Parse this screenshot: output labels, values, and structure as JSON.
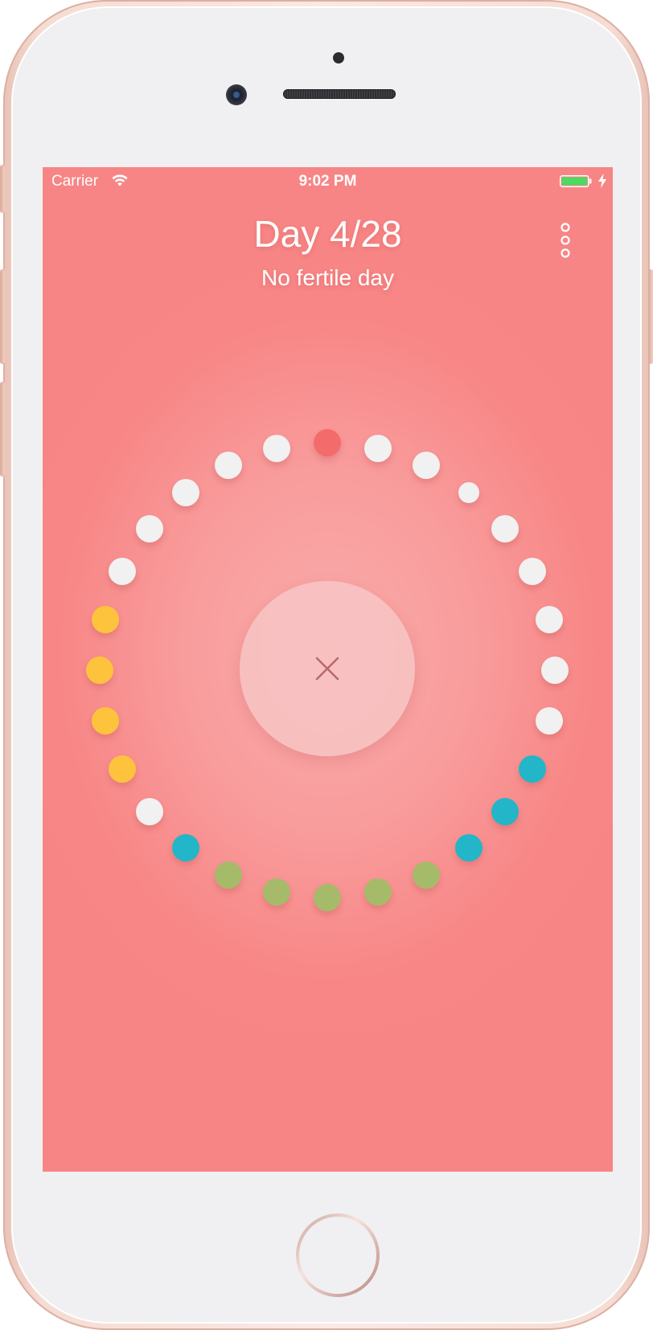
{
  "status_bar": {
    "carrier": "Carrier",
    "time": "9:02 PM",
    "wifi_icon": "wifi-icon",
    "battery_icon": "battery-full-icon",
    "charging_icon": "charging-bolt-icon",
    "battery_color": "#4cd964"
  },
  "header": {
    "title": "Day 4/28",
    "subtitle": "No fertile day",
    "menu_icon": "more-vertical-icon"
  },
  "cycle": {
    "total_days": 28,
    "current_day_index": 0,
    "colors": {
      "current": "#f36b6b",
      "default": "#f1f1f1",
      "teal": "#22b6c8",
      "green": "#a5bb6a",
      "yellow": "#fec33d"
    },
    "days": [
      "current",
      "default",
      "default",
      "default",
      "default",
      "default",
      "default",
      "default",
      "default",
      "teal",
      "teal",
      "teal",
      "green",
      "green",
      "green",
      "green",
      "green",
      "teal",
      "default",
      "yellow",
      "yellow",
      "yellow",
      "yellow",
      "default",
      "default",
      "default",
      "default",
      "default"
    ]
  },
  "center_button": {
    "icon": "close-icon"
  },
  "theme": {
    "background": "#f88585",
    "background_center": "#f9acab"
  }
}
